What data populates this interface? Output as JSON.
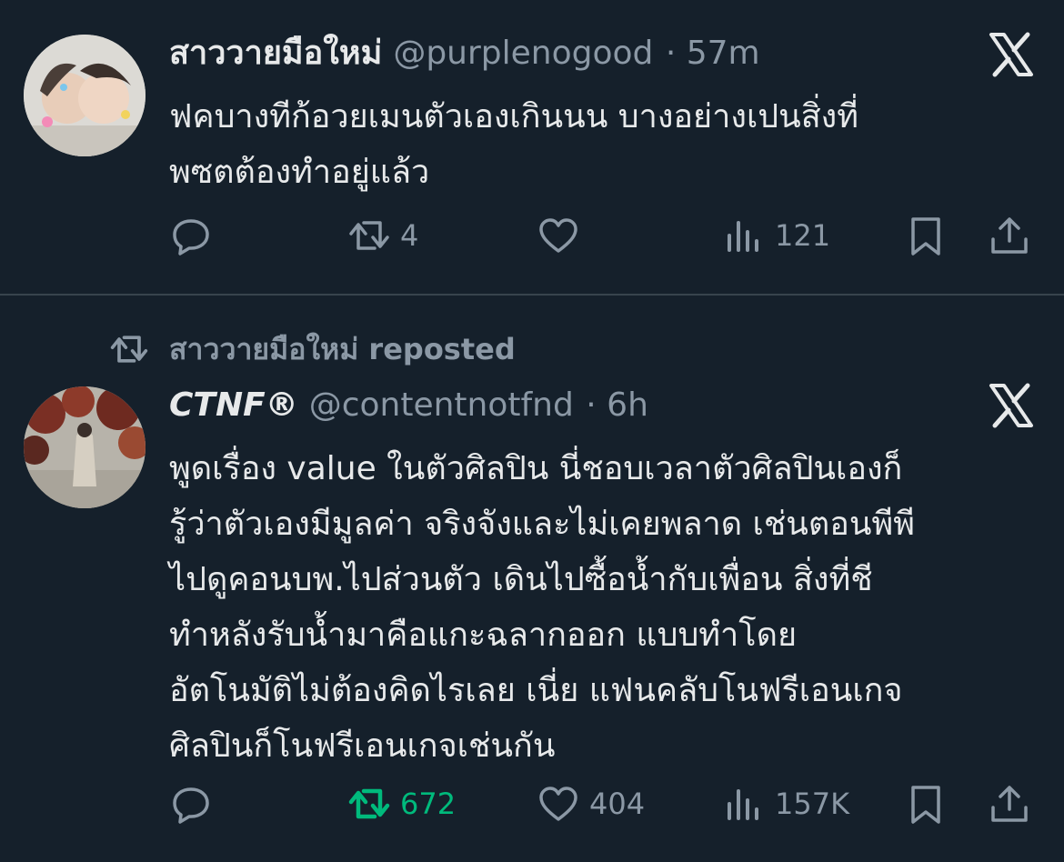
{
  "tweets": [
    {
      "display_name": "สาววายมือใหม่",
      "handle": "@purplenogood",
      "time": "· 57m",
      "text_lines": [
        "ฟคบางทีก้อวยเมนตัวเองเกินนน บางอย่างเปนสิ่งที่",
        "พซตต้องทำอยู่แล้ว"
      ],
      "retweets": "4",
      "likes": "",
      "views": "121"
    },
    {
      "reposted_by": "สาววายมือใหม่ reposted",
      "display_name": "CTNF®",
      "handle": "@contentnotfnd",
      "time": "· 6h",
      "text_lines": [
        "พูดเรื่อง value ในตัวศิลปิน นี่ชอบเวลาตัวศิลปินเองก็",
        "รู้ว่าตัวเองมีมูลค่า จริงจังและไม่เคยพลาด เช่นตอนพีพี",
        "ไปดูคอนบพ.ไปส่วนตัว เดินไปซื้อน้ำกับเพื่อน สิ่งที่ชี",
        "ทำหลังรับน้ำมาคือแกะฉลากออก แบบทำโดย",
        "อัตโนมัติไม่ต้องคิดไรเลย เนี่ย แฟนคลับโนฟรีเอนเกจ",
        "ศิลปินก็โนฟรีเอนเกจเช่นกัน"
      ],
      "retweets": "672",
      "likes": "404",
      "views": "157K"
    }
  ],
  "icons": [
    "reply-icon",
    "retweet-icon",
    "like-icon",
    "views-icon",
    "bookmark-icon",
    "share-icon",
    "x-logo-icon"
  ],
  "colors": {
    "background": "#15202b",
    "text": "#e7e9ea",
    "muted": "#8b98a5",
    "retweet_active": "#00ba7c",
    "divider": "#38444d"
  }
}
